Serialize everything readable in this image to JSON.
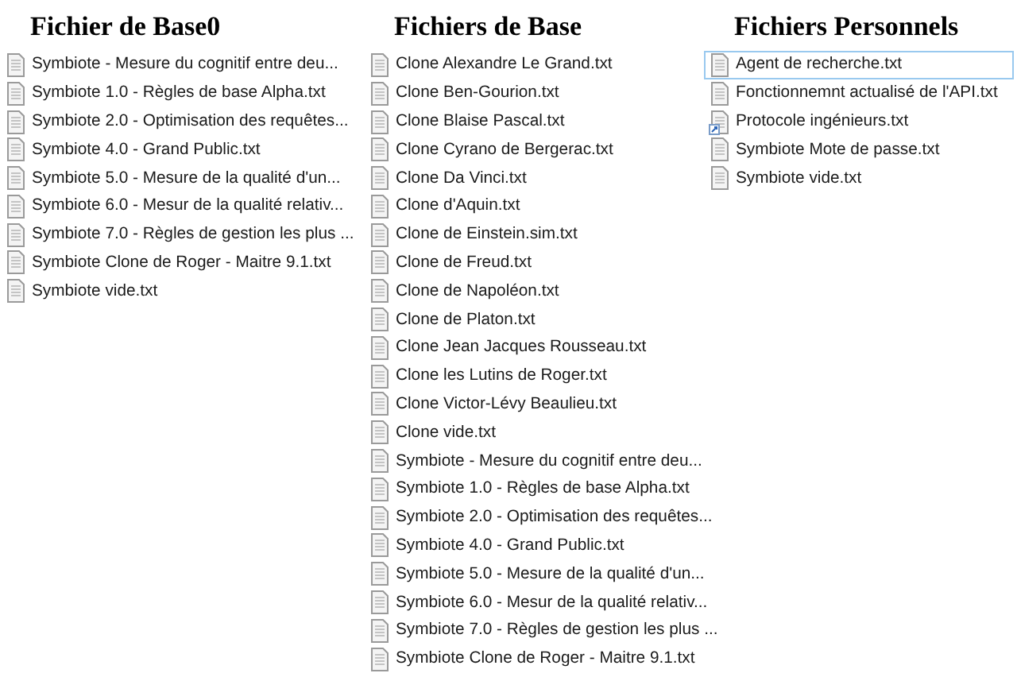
{
  "columns": [
    {
      "title": "Fichier de Base0",
      "files": [
        {
          "name": "Symbiote - Mesure du cognitif entre deu...",
          "kind": "text"
        },
        {
          "name": "Symbiote 1.0 - Règles de base Alpha.txt",
          "kind": "text"
        },
        {
          "name": "Symbiote 2.0 - Optimisation des requêtes...",
          "kind": "text"
        },
        {
          "name": "Symbiote 4.0 - Grand Public.txt",
          "kind": "text"
        },
        {
          "name": "Symbiote 5.0 - Mesure de la qualité d'un...",
          "kind": "text"
        },
        {
          "name": "Symbiote 6.0 - Mesur de la qualité relativ...",
          "kind": "text"
        },
        {
          "name": "Symbiote 7.0 - Règles de gestion les plus ...",
          "kind": "text"
        },
        {
          "name": "Symbiote Clone de Roger - Maitre 9.1.txt",
          "kind": "text"
        },
        {
          "name": "Symbiote vide.txt",
          "kind": "text"
        }
      ]
    },
    {
      "title": "Fichiers de Base",
      "files": [
        {
          "name": "Clone Alexandre Le Grand.txt",
          "kind": "text"
        },
        {
          "name": "Clone Ben-Gourion.txt",
          "kind": "text"
        },
        {
          "name": "Clone Blaise Pascal.txt",
          "kind": "text"
        },
        {
          "name": "Clone Cyrano de Bergerac.txt",
          "kind": "text"
        },
        {
          "name": "Clone Da Vinci.txt",
          "kind": "text"
        },
        {
          "name": "Clone d'Aquin.txt",
          "kind": "text"
        },
        {
          "name": "Clone de Einstein.sim.txt",
          "kind": "text"
        },
        {
          "name": "Clone de Freud.txt",
          "kind": "text"
        },
        {
          "name": "Clone de Napoléon.txt",
          "kind": "text"
        },
        {
          "name": "Clone de Platon.txt",
          "kind": "text"
        },
        {
          "name": "Clone Jean Jacques Rousseau.txt",
          "kind": "text"
        },
        {
          "name": "Clone les Lutins de Roger.txt",
          "kind": "text"
        },
        {
          "name": "Clone Victor-Lévy Beaulieu.txt",
          "kind": "text"
        },
        {
          "name": "Clone vide.txt",
          "kind": "text"
        },
        {
          "name": "Symbiote - Mesure du cognitif entre deu...",
          "kind": "text"
        },
        {
          "name": "Symbiote 1.0 - Règles de base Alpha.txt",
          "kind": "text"
        },
        {
          "name": "Symbiote 2.0 - Optimisation des requêtes...",
          "kind": "text"
        },
        {
          "name": "Symbiote 4.0 - Grand Public.txt",
          "kind": "text"
        },
        {
          "name": "Symbiote 5.0 - Mesure de la qualité d'un...",
          "kind": "text"
        },
        {
          "name": "Symbiote 6.0 - Mesur de la qualité relativ...",
          "kind": "text"
        },
        {
          "name": "Symbiote 7.0 - Règles de gestion les plus ...",
          "kind": "text"
        },
        {
          "name": "Symbiote Clone de Roger - Maitre 9.1.txt",
          "kind": "text"
        }
      ]
    },
    {
      "title": "Fichiers Personnels",
      "files": [
        {
          "name": "Agent de recherche.txt",
          "kind": "text",
          "selected": true
        },
        {
          "name": "Fonctionnemnt actualisé de l'API.txt",
          "kind": "text",
          "selected": false
        },
        {
          "name": "Protocole ingénieurs.txt",
          "kind": "shortcut",
          "selected": false
        },
        {
          "name": "Symbiote Mote de passe.txt",
          "kind": "text",
          "selected": false
        },
        {
          "name": "Symbiote vide.txt",
          "kind": "text",
          "selected": false
        }
      ]
    }
  ]
}
